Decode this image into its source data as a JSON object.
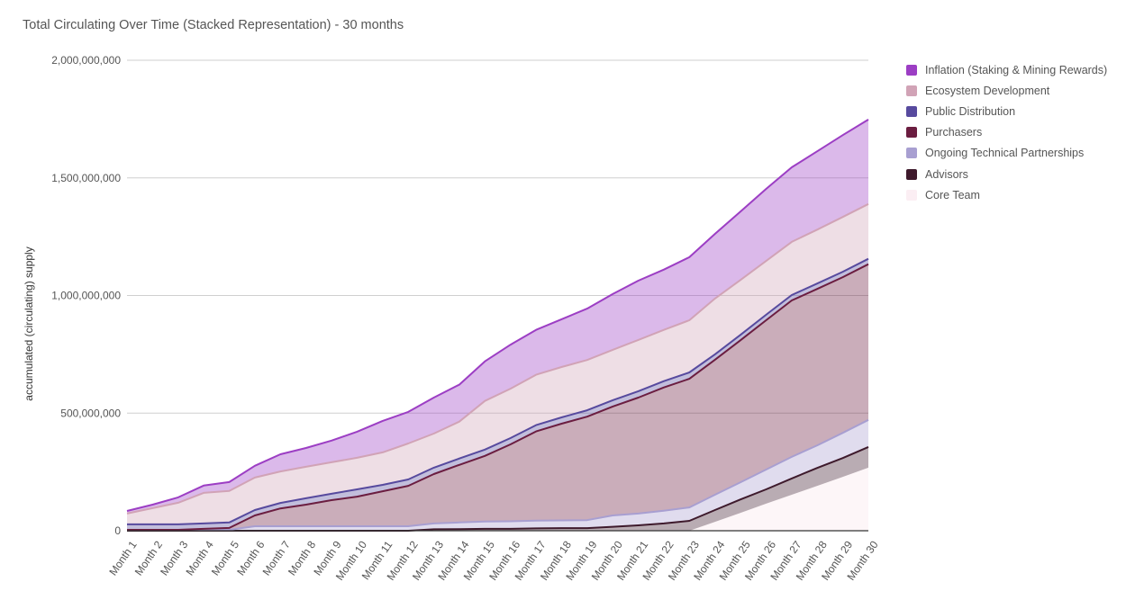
{
  "chart_data": {
    "type": "area",
    "stacked": true,
    "title": "Total Circulating Over Time (Stacked Representation) - 30 months",
    "xlabel": "",
    "ylabel": "accumulated (circulating) supply",
    "ylim": [
      0,
      2000000000
    ],
    "yticks": [
      0,
      500000000,
      1000000000,
      1500000000,
      2000000000
    ],
    "ytick_labels": [
      "0",
      "500,000,000",
      "1,000,000,000",
      "1,500,000,000",
      "2,000,000,000"
    ],
    "grid": true,
    "legend_position": "right",
    "categories": [
      "Month 1",
      "Month 2",
      "Month 3",
      "Month 4",
      "Month 5",
      "Month 6",
      "Month 7",
      "Month 8",
      "Month 9",
      "Month 10",
      "Month 11",
      "Month 12",
      "Month 13",
      "Month 14",
      "Month 15",
      "Month 16",
      "Month 17",
      "Month 18",
      "Month 19",
      "Month 20",
      "Month 21",
      "Month 22",
      "Month 23",
      "Month 24",
      "Month 25",
      "Month 26",
      "Month 27",
      "Month 28",
      "Month 29",
      "Month 30"
    ],
    "series_stack_order": "bottom-to-top",
    "series": [
      {
        "name": "Core Team",
        "color": "#fbeef3",
        "line": "#fbeef3",
        "values": [
          0,
          0,
          0,
          0,
          0,
          0,
          0,
          0,
          0,
          0,
          0,
          0,
          0,
          0,
          0,
          0,
          0,
          0,
          0,
          0,
          0,
          0,
          0,
          38000000,
          76000000,
          115000000,
          153000000,
          191000000,
          229000000,
          268000000
        ]
      },
      {
        "name": "Advisors",
        "color": "#3e1a2c",
        "line": "#3e1a2c",
        "values": [
          0,
          0,
          0,
          0,
          0,
          0,
          0,
          0,
          0,
          0,
          0,
          0,
          6000000,
          7000000,
          8000000,
          8000000,
          10000000,
          11000000,
          11000000,
          17000000,
          23000000,
          31000000,
          42000000,
          50000000,
          57000000,
          61000000,
          69000000,
          76000000,
          80000000,
          88000000
        ]
      },
      {
        "name": "Ongoing Technical Partnerships",
        "color": "#a89fd1",
        "line": "#a89fd1",
        "values": [
          4000000,
          4000000,
          4000000,
          4000000,
          4000000,
          19000000,
          19000000,
          19000000,
          19000000,
          19000000,
          19000000,
          19000000,
          25000000,
          28000000,
          31000000,
          32000000,
          33000000,
          33000000,
          34000000,
          48000000,
          50000000,
          54000000,
          57000000,
          65000000,
          73000000,
          84000000,
          92000000,
          96000000,
          107000000,
          115000000
        ]
      },
      {
        "name": "Purchasers",
        "color": "#6b1d40",
        "line": "#6b1d40",
        "values": [
          0,
          0,
          0,
          4000000,
          8000000,
          46000000,
          76000000,
          92000000,
          111000000,
          126000000,
          149000000,
          172000000,
          210000000,
          245000000,
          279000000,
          327000000,
          379000000,
          411000000,
          440000000,
          463000000,
          493000000,
          524000000,
          547000000,
          574000000,
          604000000,
          635000000,
          665000000,
          665000000,
          662000000,
          662000000
        ]
      },
      {
        "name": "Public Distribution",
        "color": "#574a9e",
        "line": "#574a9e",
        "values": [
          23000000,
          23000000,
          23000000,
          23000000,
          23000000,
          23000000,
          23000000,
          27000000,
          27000000,
          31000000,
          27000000,
          27000000,
          27000000,
          27000000,
          27000000,
          27000000,
          27000000,
          27000000,
          27000000,
          27000000,
          27000000,
          27000000,
          27000000,
          23000000,
          23000000,
          23000000,
          23000000,
          23000000,
          23000000,
          23000000
        ]
      },
      {
        "name": "Ecosystem Development",
        "color": "#d1a3b6",
        "line": "#d1a3b6",
        "values": [
          46000000,
          69000000,
          92000000,
          130000000,
          134000000,
          138000000,
          134000000,
          134000000,
          134000000,
          134000000,
          138000000,
          153000000,
          145000000,
          157000000,
          207000000,
          210000000,
          214000000,
          214000000,
          214000000,
          214000000,
          218000000,
          218000000,
          222000000,
          237000000,
          233000000,
          229000000,
          226000000,
          229000000,
          233000000,
          233000000
        ]
      },
      {
        "name": "Inflation (Staking & Mining Rewards)",
        "color": "#9c3ec4",
        "line": "#9c3ec4",
        "values": [
          11000000,
          15000000,
          23000000,
          31000000,
          38000000,
          50000000,
          73000000,
          80000000,
          92000000,
          111000000,
          134000000,
          134000000,
          153000000,
          157000000,
          168000000,
          187000000,
          191000000,
          203000000,
          218000000,
          237000000,
          252000000,
          256000000,
          268000000,
          275000000,
          291000000,
          306000000,
          317000000,
          333000000,
          348000000,
          359000000
        ]
      }
    ],
    "legend_order": [
      "Inflation (Staking & Mining Rewards)",
      "Ecosystem Development",
      "Public Distribution",
      "Purchasers",
      "Ongoing Technical Partnerships",
      "Advisors",
      "Core Team"
    ],
    "legend_colors": [
      "#9c3ec4",
      "#d1a3b6",
      "#574a9e",
      "#6b1d40",
      "#a89fd1",
      "#3e1a2c",
      "#fbeef3"
    ]
  }
}
